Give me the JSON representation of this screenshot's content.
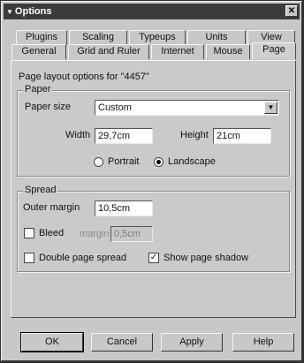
{
  "window": {
    "title": "Options",
    "close_glyph": "✕"
  },
  "tabs": {
    "row1": [
      "Plugins",
      "Scaling",
      "Typeups",
      "Units",
      "View"
    ],
    "row2": [
      "General",
      "Grid and Ruler",
      "Internet",
      "Mouse",
      "Page"
    ],
    "active": "Page"
  },
  "page": {
    "description": "Page layout options for \"4457\"",
    "paper": {
      "group_title": "Paper",
      "size_label": "Paper size",
      "size_value": "Custom",
      "width_label": "Width",
      "width_value": "29,7cm",
      "height_label": "Height",
      "height_value": "21cm",
      "orientation": [
        {
          "label": "Portrait",
          "selected": false
        },
        {
          "label": "Landscape",
          "selected": true
        }
      ]
    },
    "spread": {
      "group_title": "Spread",
      "outer_margin_label": "Outer margin",
      "outer_margin_value": "10,5cm",
      "bleed_label": "Bleed",
      "bleed_checked": false,
      "bleed_margin_label": "margin",
      "bleed_margin_value": "0,5cm",
      "double_spread_label": "Double page spread",
      "double_spread_checked": false,
      "show_shadow_label": "Show page shadow",
      "show_shadow_checked": true
    }
  },
  "buttons": {
    "ok": "OK",
    "cancel": "Cancel",
    "apply": "Apply",
    "help": "Help"
  }
}
